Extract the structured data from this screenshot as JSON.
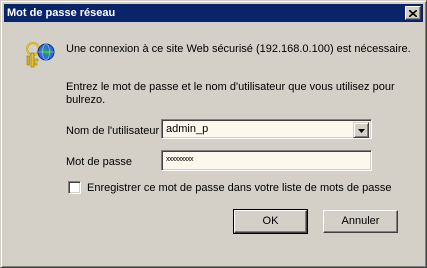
{
  "window": {
    "title": "Mot de passe réseau",
    "close_icon": "close-icon"
  },
  "icon": {
    "name": "keys-icon"
  },
  "message": {
    "line1": "Une connexion à ce site Web sécurisé (192.168.0.100) est nécessaire.",
    "line2": "Entrez le mot de passe et le nom d'utilisateur que vous utilisez pour",
    "line3": "bulrezo."
  },
  "form": {
    "username_label": "Nom de l'utilisateur",
    "username_value": "admin_p",
    "password_label": "Mot de passe",
    "password_mask": "xxxxxxxxx",
    "remember_label": "Enregistrer ce mot de passe dans votre liste de mots de passe",
    "remember_checked": false
  },
  "buttons": {
    "ok": "OK",
    "cancel": "Annuler"
  },
  "colors": {
    "titlebar": "#0a246a",
    "face": "#d4d0c8",
    "field_bg": "#fdf8ec",
    "key_gold": "#e8c21a",
    "globe_blue": "#2f6fd6"
  }
}
